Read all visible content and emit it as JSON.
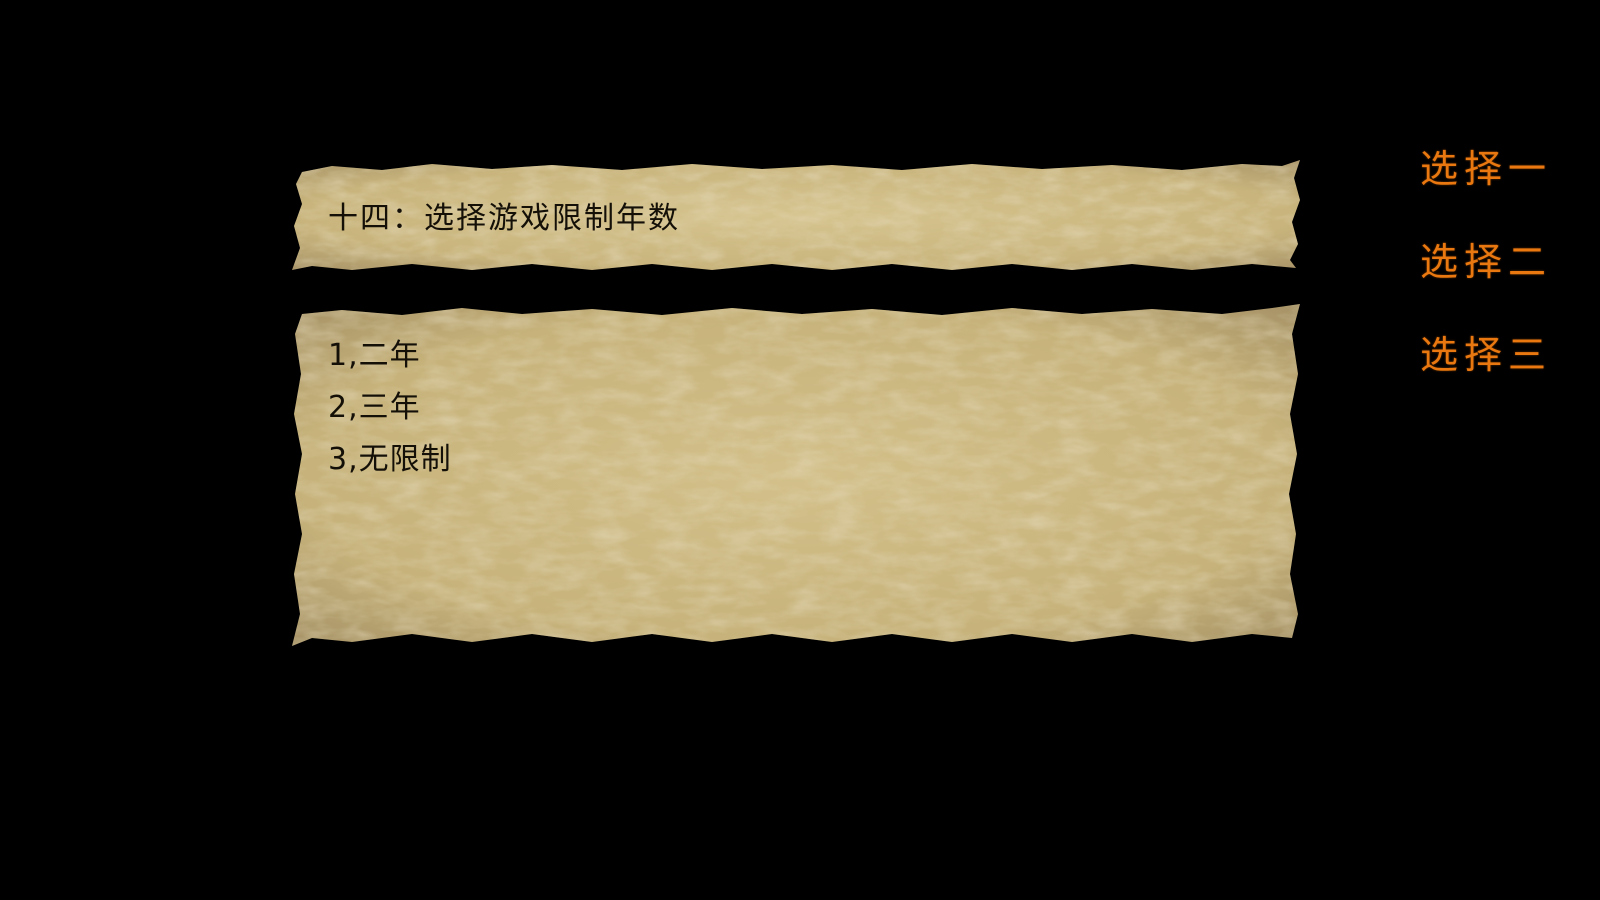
{
  "question": {
    "title": "十四：选择游戏限制年数"
  },
  "options": [
    {
      "label": "1,二年"
    },
    {
      "label": "2,三年"
    },
    {
      "label": "3,无限制"
    }
  ],
  "choices": [
    {
      "label": "选择一"
    },
    {
      "label": "选择二"
    },
    {
      "label": "选择三"
    }
  ],
  "colors": {
    "background": "#000000",
    "parchment": "#cfbd86",
    "parchment_shadow": "#a8966a",
    "text": "#141008",
    "choice_text": "#e8780f"
  }
}
